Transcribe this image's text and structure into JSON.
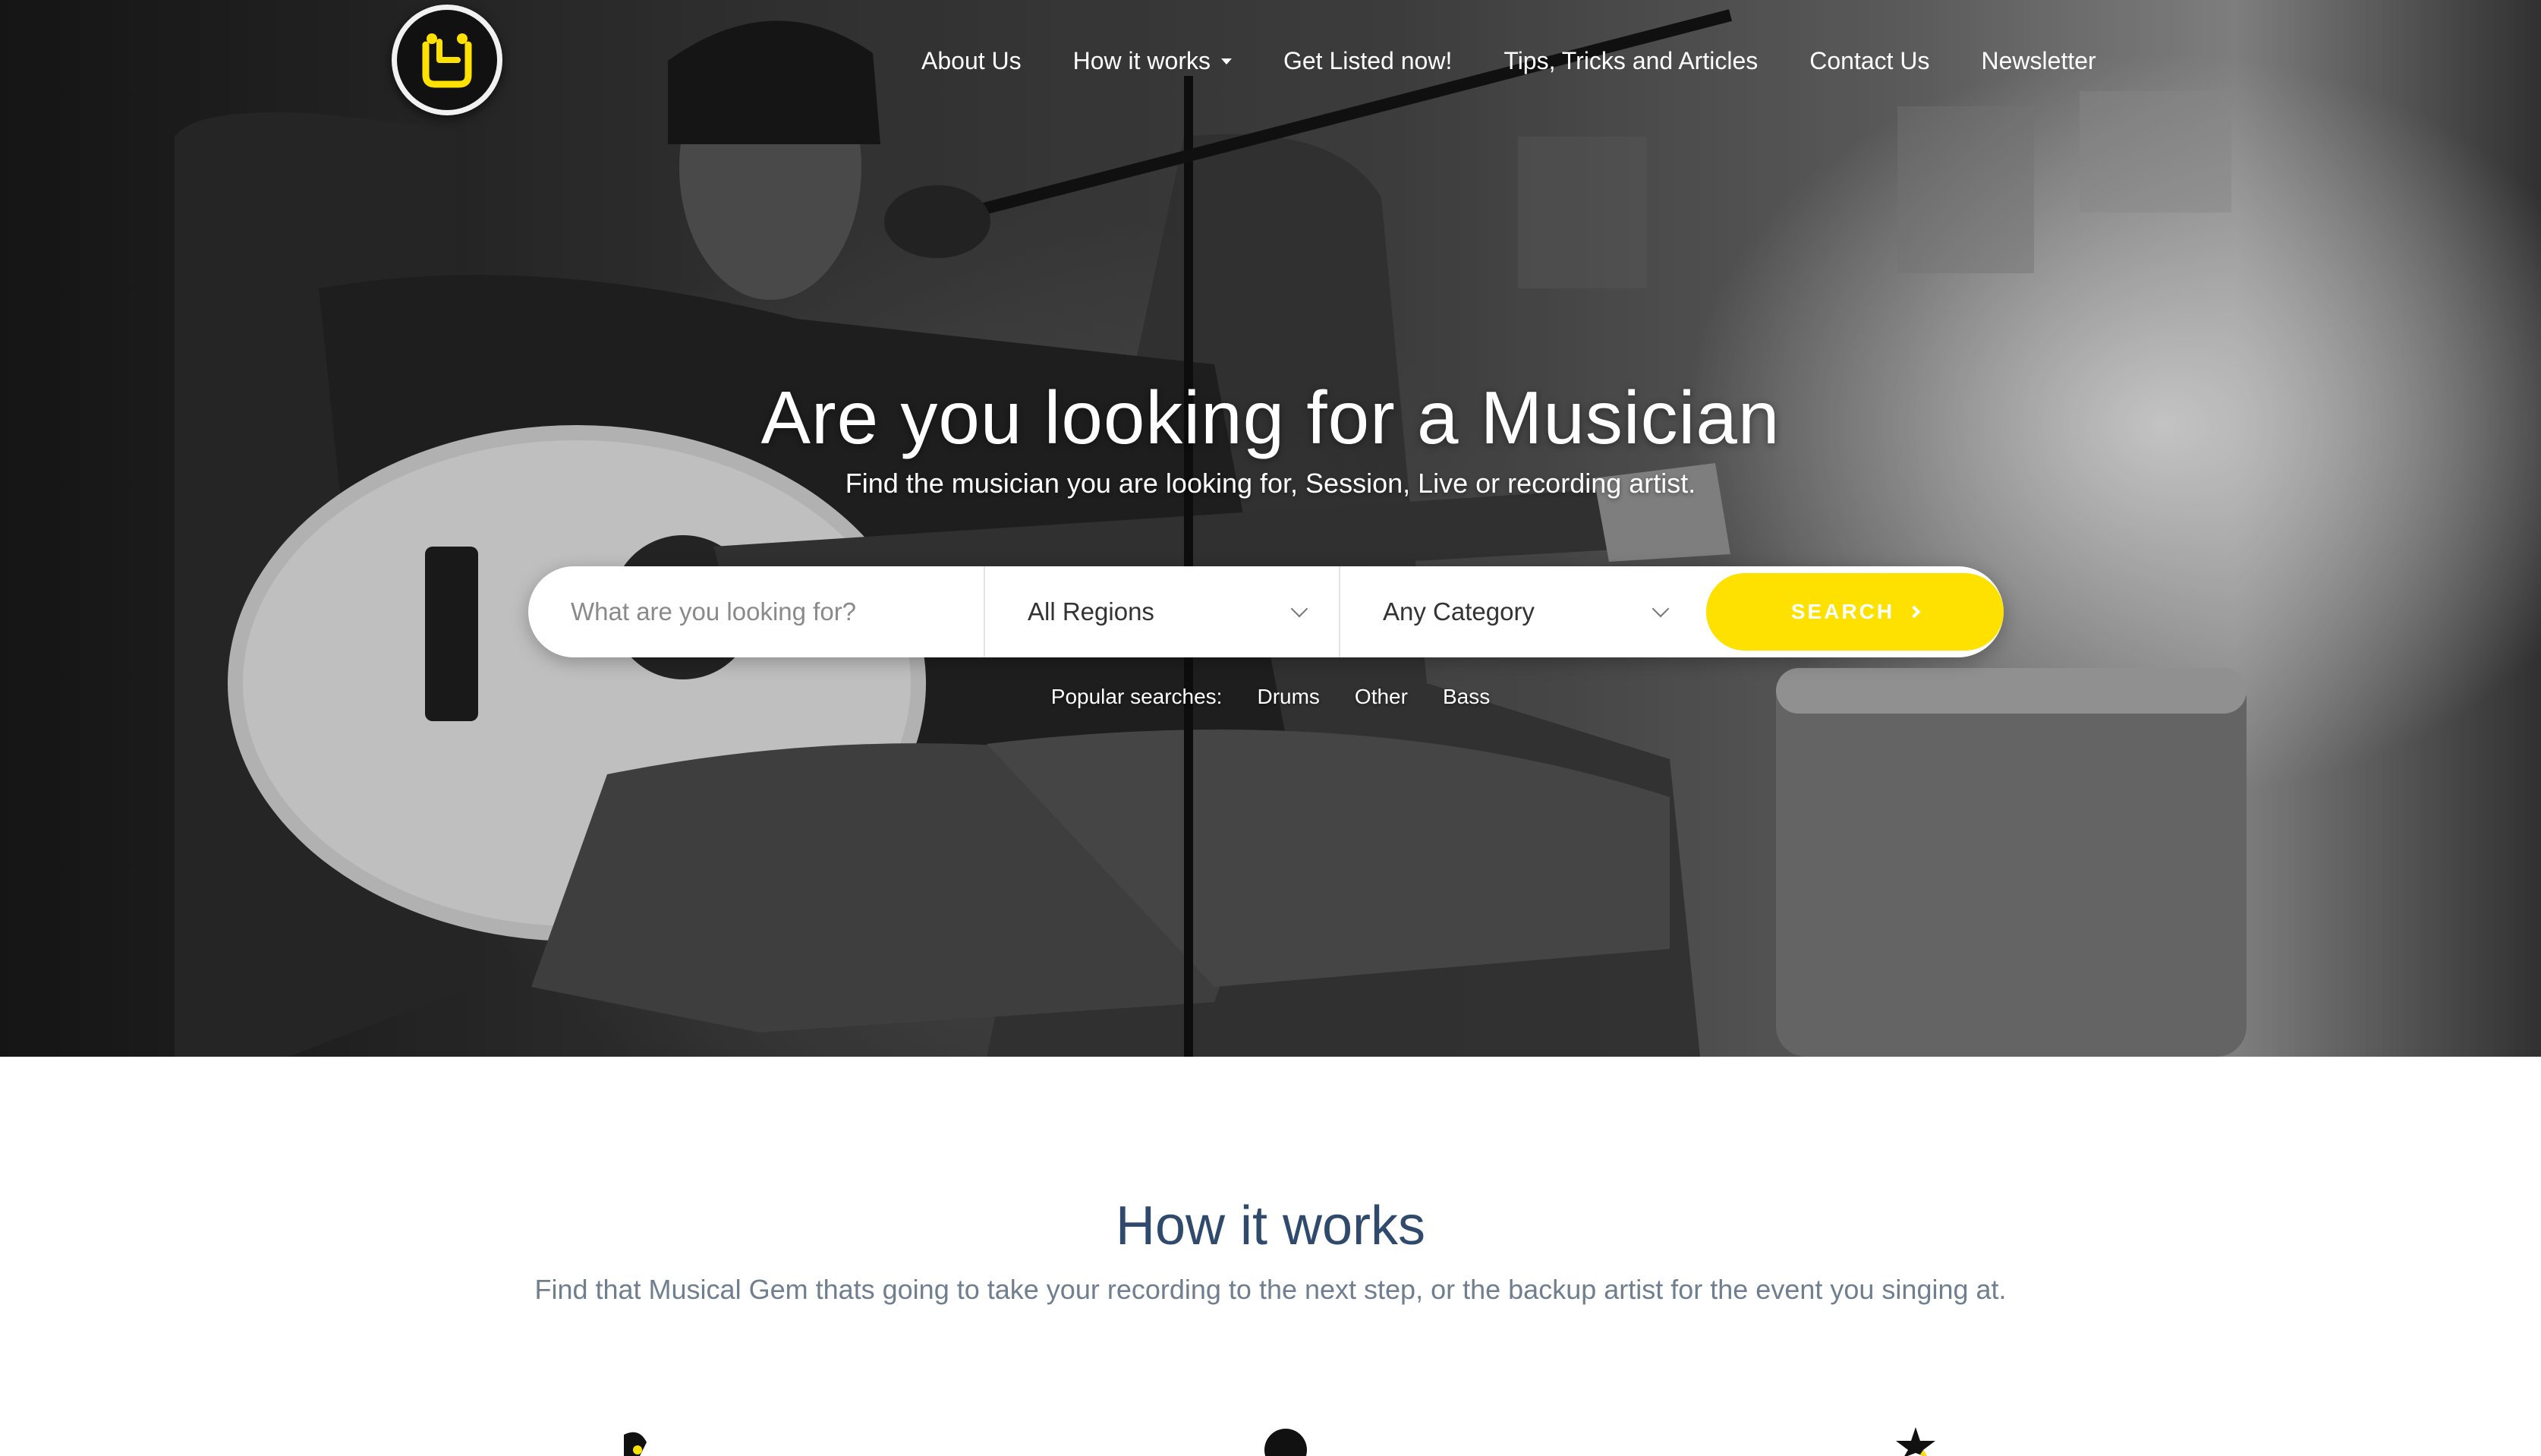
{
  "nav": {
    "items": [
      {
        "label": "About Us"
      },
      {
        "label": "How it works"
      },
      {
        "label": "Get Listed now!"
      },
      {
        "label": "Tips, Tricks and Articles"
      },
      {
        "label": "Contact Us"
      },
      {
        "label": "Newsletter"
      }
    ]
  },
  "hero": {
    "title": "Are you looking for a Musician",
    "subtitle": "Find the musician you are looking for, Session, Live or recording artist."
  },
  "search": {
    "placeholder": "What are you looking for?",
    "region_selected": "All Regions",
    "category_selected": "Any Category",
    "button_label": "SEARCH"
  },
  "popular": {
    "label": "Popular searches:",
    "tags": [
      "Drums",
      "Other",
      "Bass"
    ]
  },
  "how_it_works": {
    "title": "How it works",
    "subtitle": "Find that Musical Gem thats going to take your recording to the next step, or the backup artist for the event you singing at."
  },
  "colors": {
    "accent": "#ffe100",
    "heading": "#2f4a6d",
    "subtext": "#6f7f8f"
  },
  "icons": [
    "logo-icon",
    "caret-down-icon",
    "chevron-down-icon",
    "arrow-right-icon",
    "pencil-icon",
    "user-icon",
    "star-icon"
  ]
}
